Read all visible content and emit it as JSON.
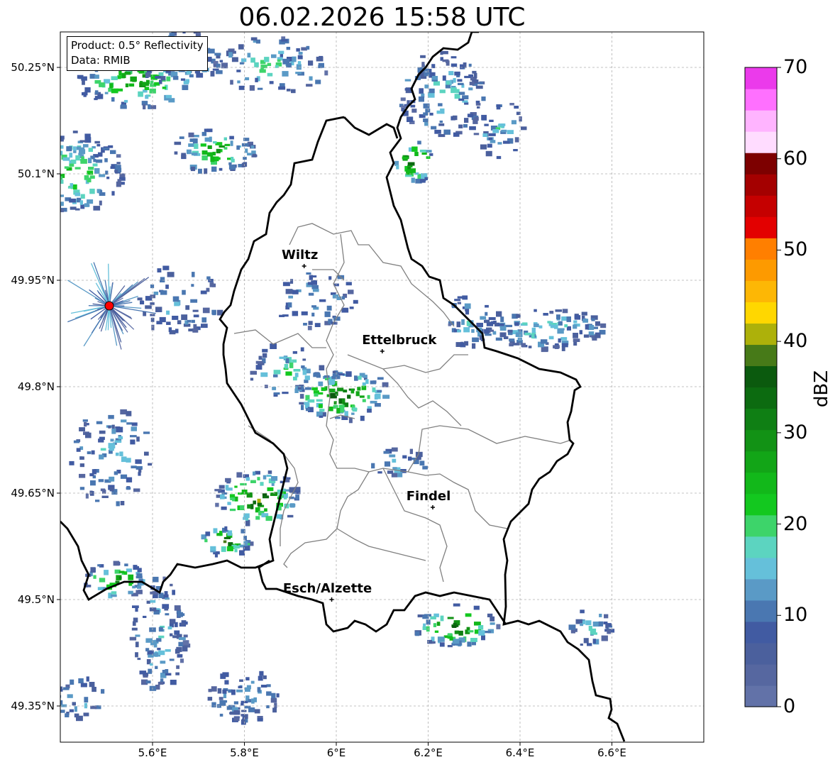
{
  "title": "06.02.2026 15:58 UTC",
  "info": {
    "product": "Product: 0.5° Reflectivity",
    "data": "Data: RMIB"
  },
  "axes": {
    "lon_ticks": [
      "5.6°E",
      "5.8°E",
      "6°E",
      "6.2°E",
      "6.4°E",
      "6.6°E"
    ],
    "lat_ticks": [
      "50.25°N",
      "50.1°N",
      "49.95°N",
      "49.8°N",
      "49.65°N",
      "49.5°N",
      "49.35°N"
    ]
  },
  "colorbar": {
    "label": "dBZ",
    "ticks": [
      "0",
      "10",
      "20",
      "30",
      "40",
      "50",
      "60",
      "70"
    ],
    "colors": [
      "#6272a8",
      "#5667a0",
      "#4b609d",
      "#415ba2",
      "#4a77b1",
      "#5a9ac6",
      "#65c0da",
      "#5cd4c0",
      "#3dd46a",
      "#13c81f",
      "#12b81a",
      "#12a517",
      "#129215",
      "#0f7f14",
      "#0c6b10",
      "#0b5a0e",
      "#477a18",
      "#adb10a",
      "#ffd700",
      "#fdb705",
      "#fd9a00",
      "#ff7f00",
      "#e30000",
      "#c50000",
      "#a40000",
      "#7d0000",
      "#ffdcff",
      "#ffb4ff",
      "#ff70ff",
      "#eb3aeb"
    ],
    "brand_red": "#ff0000"
  },
  "radar_site": {
    "color": "#ff0000"
  },
  "cities": [
    {
      "name": "Wiltz",
      "lon": 5.93,
      "lat": 49.97
    },
    {
      "name": "Ettelbruck",
      "lon": 6.1,
      "lat": 49.85
    },
    {
      "name": "Findel",
      "lon": 6.21,
      "lat": 49.63
    },
    {
      "name": "Esch/Alzette",
      "lon": 5.99,
      "lat": 49.5
    }
  ]
}
